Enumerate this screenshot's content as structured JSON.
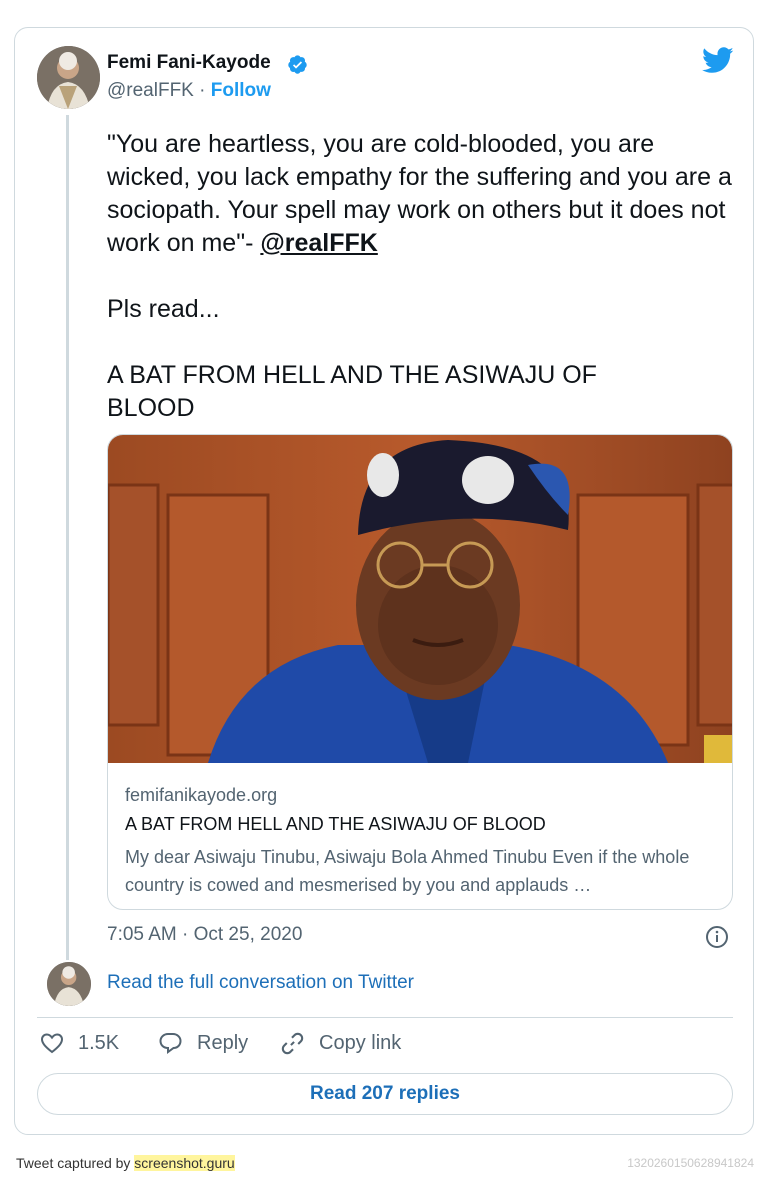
{
  "author": {
    "name": "Femi Fani-Kayode",
    "handle": "@realFFK",
    "separator": "·",
    "follow_label": "Follow"
  },
  "tweet": {
    "quote": "\"You are heartless, you are cold-blooded, you are wicked, you lack empathy for the suffering and you are a sociopath. Your spell may work on others but it does not work on me\"- ",
    "mention": "@realFFK",
    "line2": "Pls read...",
    "line3": "A BAT FROM HELL AND THE ASIWAJU OF BLOOD",
    "timestamp": "7:05 AM · Oct 25, 2020"
  },
  "link_card": {
    "domain": "femifanikayode.org",
    "title": "A BAT FROM HELL AND THE ASIWAJU OF BLOOD",
    "description": "My dear Asiwaju Tinubu, Asiwaju Bola Ahmed Tinubu Even if the whole country is cowed and mesmerised by you and applauds …"
  },
  "conversation_link": "Read the full conversation on Twitter",
  "actions": {
    "likes": "1.5K",
    "reply": "Reply",
    "copy_link": "Copy link"
  },
  "read_replies": "Read 207 replies",
  "footer": {
    "captured_by": "Tweet captured by ",
    "site": "screenshot.guru",
    "tweet_id": "1320260150628941824"
  },
  "colors": {
    "brand_blue": "#1d9bf0",
    "link_blue": "#1d6fb8",
    "muted_text": "#536471",
    "border": "#cfd9de"
  },
  "icons": [
    "verified-badge-icon",
    "twitter-bird-icon",
    "info-icon",
    "heart-icon",
    "reply-bubble-icon",
    "link-chain-icon"
  ]
}
